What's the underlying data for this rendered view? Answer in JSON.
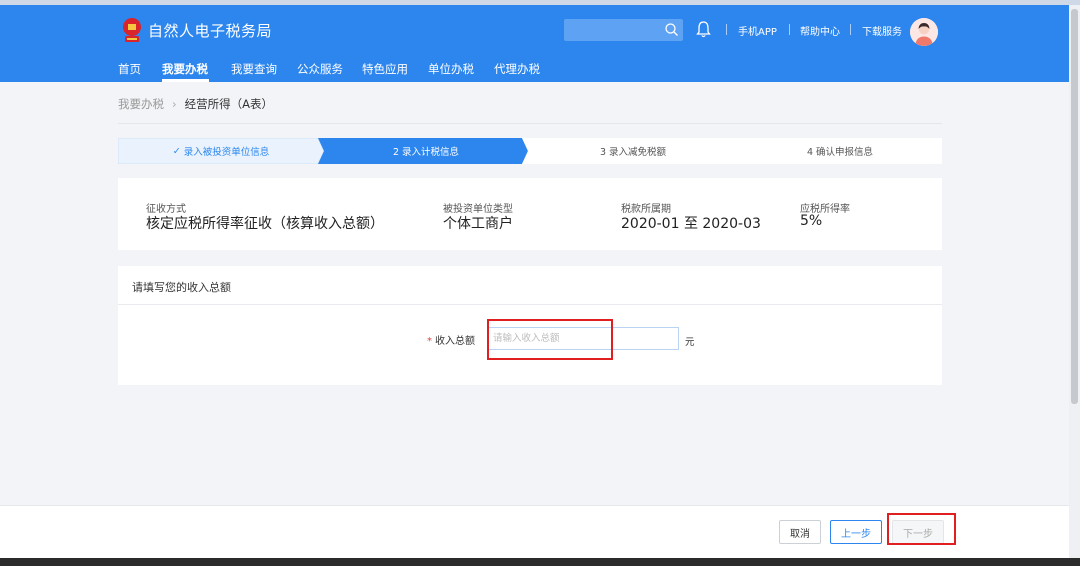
{
  "header": {
    "brand": "自然人电子税务局",
    "search": {
      "placeholder": "",
      "value": ""
    },
    "links": {
      "mobile_app": "手机APP",
      "help": "帮助中心",
      "download": "下载服务"
    }
  },
  "nav": {
    "items": [
      "首页",
      "我要办税",
      "我要查询",
      "公众服务",
      "特色应用",
      "单位办税",
      "代理办税"
    ],
    "active": "我要办税"
  },
  "breadcrumb": {
    "parent": "我要办税",
    "current": "经营所得（A表）"
  },
  "steps": [
    {
      "label": "录入被投资单位信息",
      "state": "done"
    },
    {
      "label": "2 录入计税信息",
      "state": "active"
    },
    {
      "label": "3 录入减免税额",
      "state": "pending"
    },
    {
      "label": "4 确认申报信息",
      "state": "pending"
    }
  ],
  "info": {
    "levy_method": {
      "label": "征收方式",
      "value": "核定应税所得率征收（核算收入总额）"
    },
    "unit_type": {
      "label": "被投资单位类型",
      "value": "个体工商户"
    },
    "period": {
      "label": "税款所属期",
      "value": "2020-01 至 2020-03"
    },
    "rate": {
      "label": "应税所得率",
      "value": "5%"
    }
  },
  "income": {
    "title": "请填写您的收入总额",
    "required_mark": "*",
    "label": "收入总额",
    "placeholder": "请输入收入总额",
    "value": "",
    "unit": "元"
  },
  "footer": {
    "cancel": "取消",
    "prev": "上一步",
    "next": "下一步"
  },
  "colors": {
    "primary": "#2d86ee",
    "step_done_bg": "#eaf3fd",
    "step_active_bg": "#2d86ee",
    "highlight": "#e02020"
  }
}
